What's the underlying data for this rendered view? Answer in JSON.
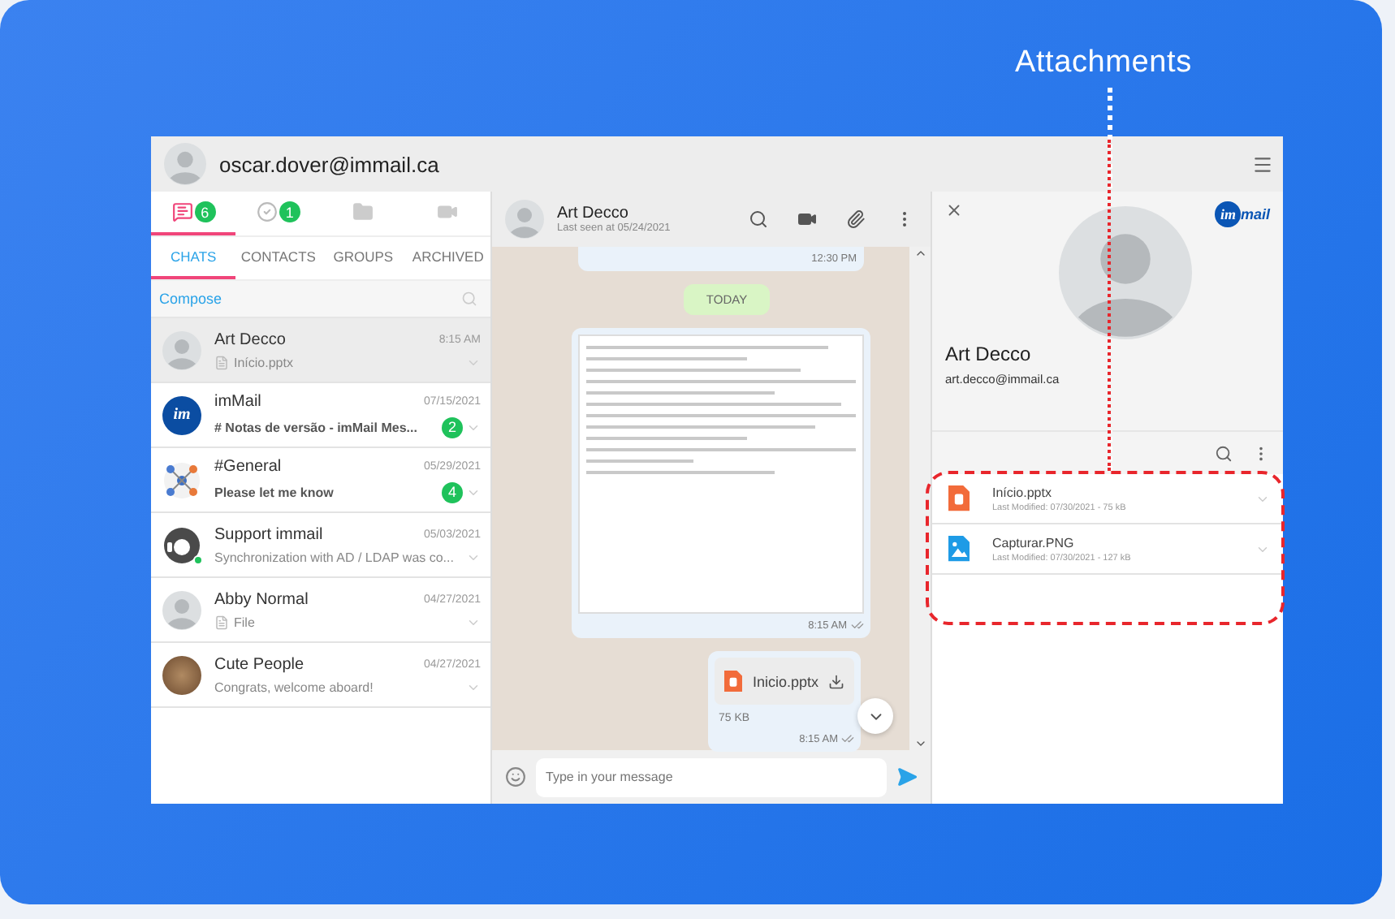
{
  "annotation": {
    "label": "Attachments"
  },
  "account": {
    "email": "oscar.dover@immail.ca"
  },
  "nav_icons": [
    {
      "kind": "chat",
      "badge": "6",
      "selected": true
    },
    {
      "kind": "check",
      "badge": "1",
      "selected": false
    },
    {
      "kind": "folder",
      "selected": false
    },
    {
      "kind": "video",
      "selected": false
    }
  ],
  "tabs": [
    {
      "label": "CHATS",
      "selected": true
    },
    {
      "label": "CONTACTS",
      "selected": false
    },
    {
      "label": "GROUPS",
      "selected": false
    },
    {
      "label": "ARCHIVED",
      "selected": false
    }
  ],
  "compose": "Compose",
  "chats": [
    {
      "name": "Art Decco",
      "time": "8:15 AM",
      "preview": "Início.pptx",
      "has_file": true,
      "kind": "person",
      "selected": true,
      "online": false
    },
    {
      "name": "imMail",
      "time": "07/15/2021",
      "preview": "# Notas de versão - imMail Mes...",
      "has_file": false,
      "badge": "2",
      "kind": "logo",
      "avatar_text": "im",
      "selected": false,
      "online": false
    },
    {
      "name": "#General",
      "time": "05/29/2021",
      "preview": "Please let me know",
      "has_file": false,
      "badge": "4",
      "kind": "group",
      "selected": false,
      "online": false
    },
    {
      "name": "Support immail",
      "time": "05/03/2021",
      "preview": "Synchronization with AD / LDAP was co...",
      "has_file": false,
      "kind": "support",
      "selected": false,
      "online": true
    },
    {
      "name": "Abby Normal",
      "time": "04/27/2021",
      "preview": "File",
      "has_file": true,
      "kind": "person",
      "selected": false,
      "online": false
    },
    {
      "name": "Cute People",
      "time": "04/27/2021",
      "preview": "Congrats, welcome aboard!",
      "has_file": false,
      "kind": "photo",
      "selected": false,
      "online": false
    }
  ],
  "conversation": {
    "name": "Art Decco",
    "status": "Last seen at 05/24/2021",
    "earlier_time": "12:30 PM",
    "day": "TODAY",
    "messages": [
      {
        "kind": "image",
        "time": "8:15 AM"
      },
      {
        "kind": "file",
        "file_name": "Inicio.pptx",
        "size": "75 KB",
        "time": "8:15 AM"
      }
    ],
    "input_placeholder": "Type in your message"
  },
  "contact": {
    "name": "Art Decco",
    "email": "art.decco@immail.ca",
    "logo": {
      "first": "im",
      "second": "mail"
    }
  },
  "attachments": [
    {
      "name": "Início.pptx",
      "meta": "Last Modified: 07/30/2021 - 75 kB",
      "kind": "pptx"
    },
    {
      "name": "Capturar.PNG",
      "meta": "Last Modified: 07/30/2021 - 127 kB",
      "kind": "image"
    }
  ]
}
